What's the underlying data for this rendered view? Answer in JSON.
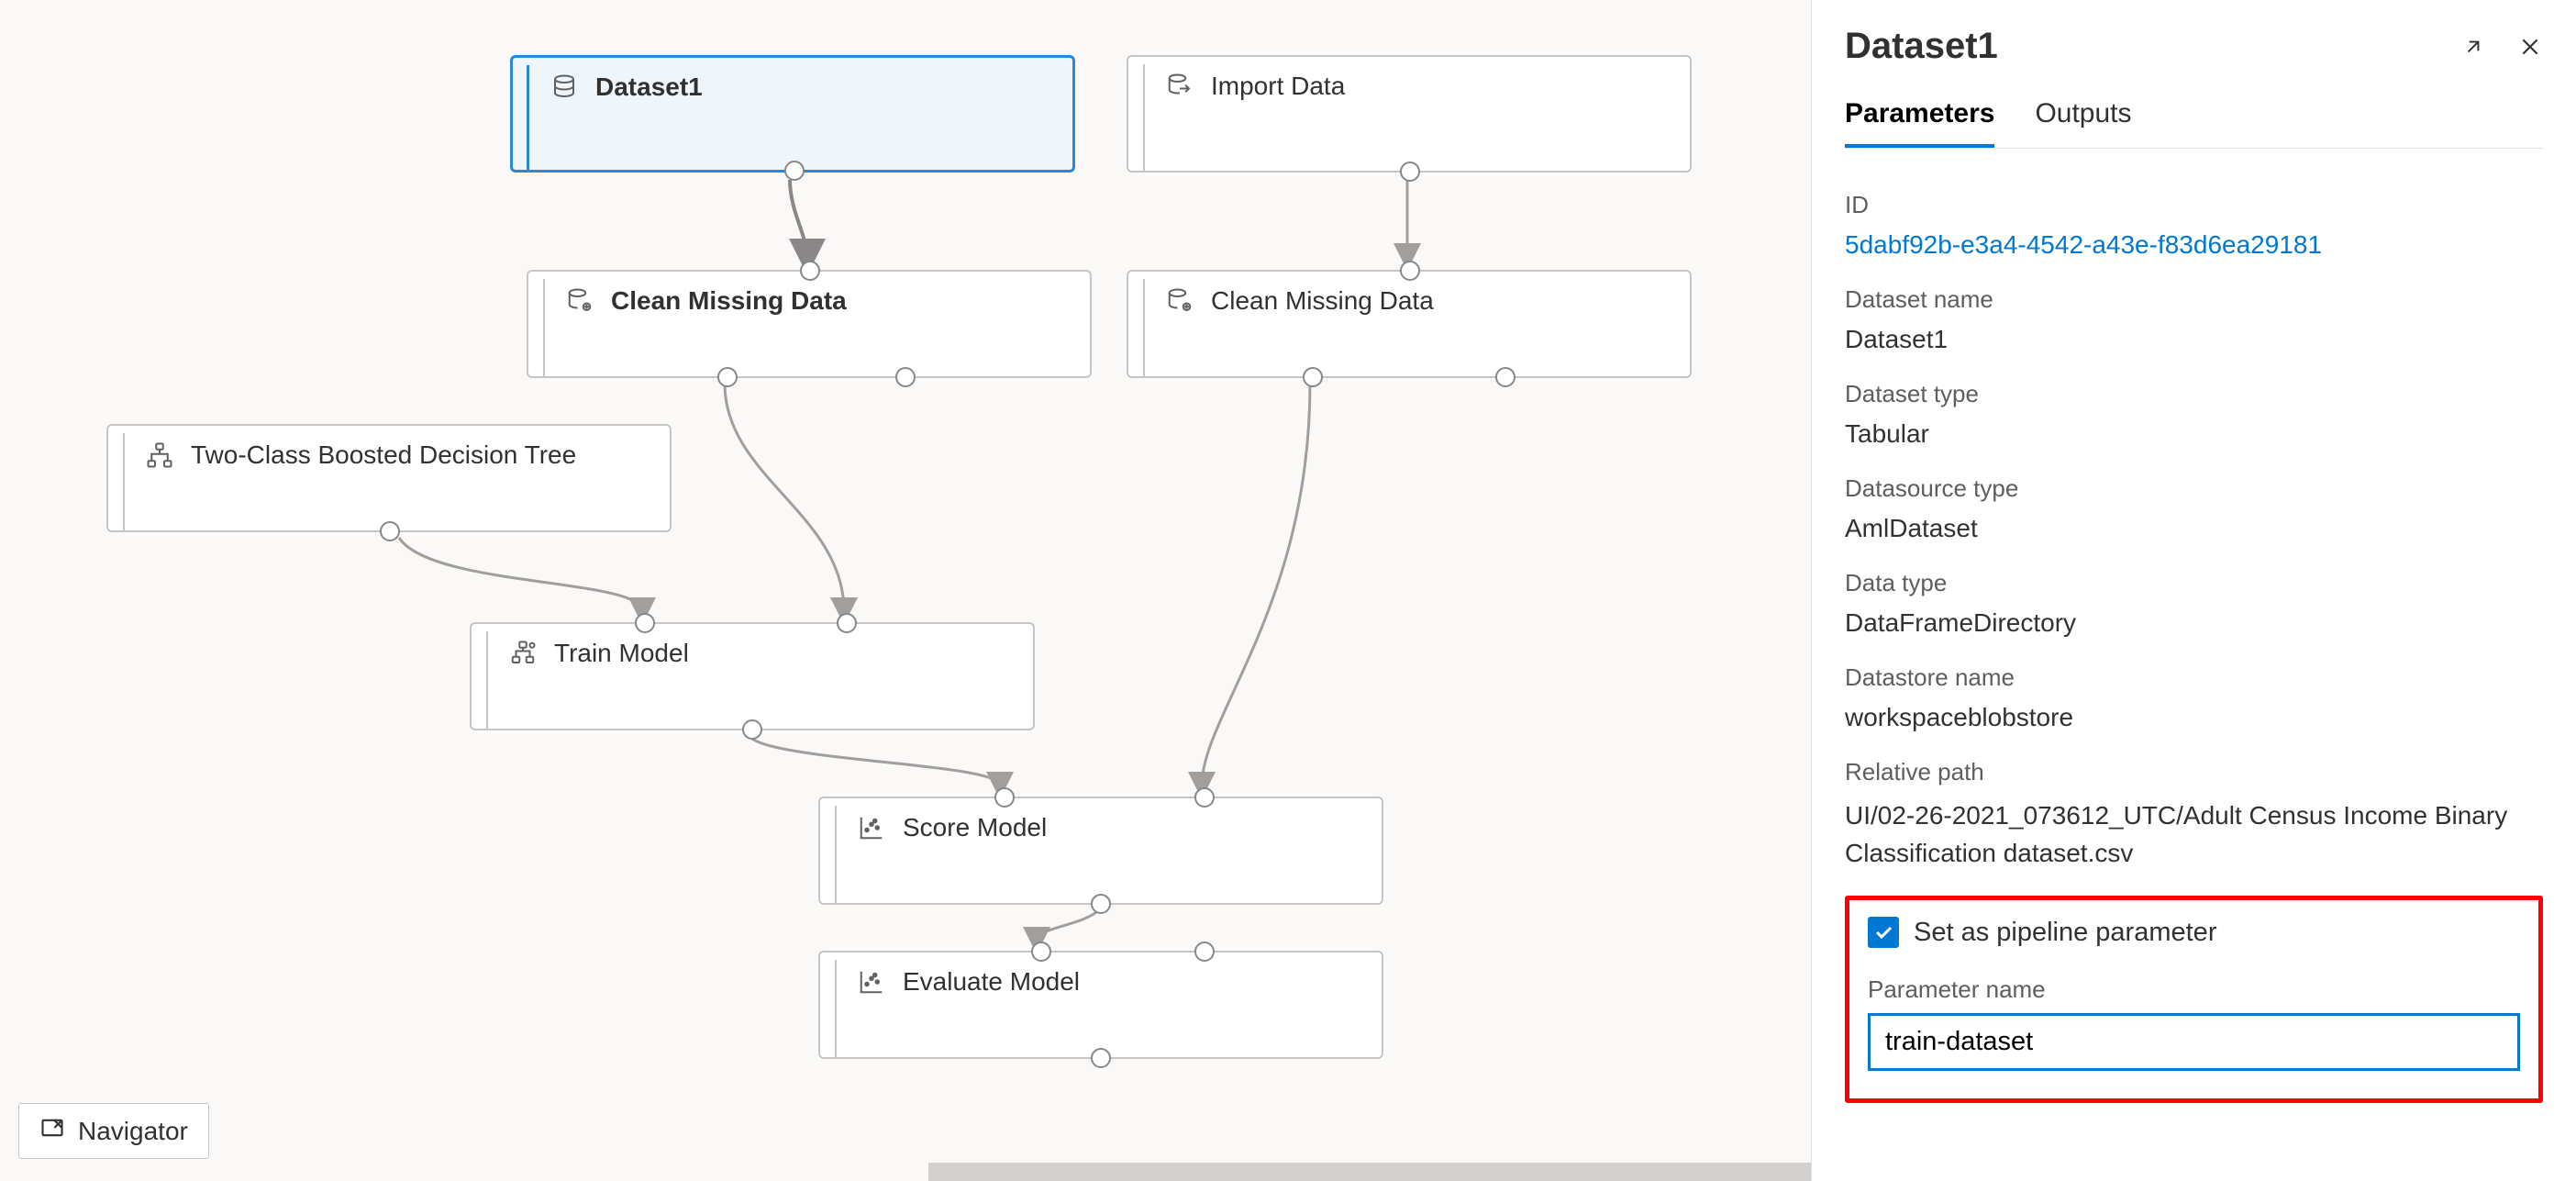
{
  "canvas": {
    "nodes": {
      "dataset1": "Dataset1",
      "import_data": "Import Data",
      "clean_missing_left": "Clean Missing Data",
      "clean_missing_right": "Clean Missing Data",
      "two_class": "Two-Class Boosted Decision Tree",
      "train_model": "Train Model",
      "score_model": "Score Model",
      "evaluate_model": "Evaluate Model"
    },
    "navigator_label": "Navigator"
  },
  "panel": {
    "title": "Dataset1",
    "tabs": {
      "parameters": "Parameters",
      "outputs": "Outputs"
    },
    "fields": {
      "id_label": "ID",
      "id_value": "5dabf92b-e3a4-4542-a43e-f83d6ea29181",
      "dataset_name_label": "Dataset name",
      "dataset_name_value": "Dataset1",
      "dataset_type_label": "Dataset type",
      "dataset_type_value": "Tabular",
      "datasource_type_label": "Datasource type",
      "datasource_type_value": "AmlDataset",
      "data_type_label": "Data type",
      "data_type_value": "DataFrameDirectory",
      "datastore_name_label": "Datastore name",
      "datastore_name_value": "workspaceblobstore",
      "relative_path_label": "Relative path",
      "relative_path_value": "UI/02-26-2021_073612_UTC/Adult Census Income Binary Classification dataset.csv"
    },
    "pipeline_param": {
      "checkbox_label": "Set as pipeline parameter",
      "param_name_label": "Parameter name",
      "param_name_value": "train-dataset"
    }
  }
}
